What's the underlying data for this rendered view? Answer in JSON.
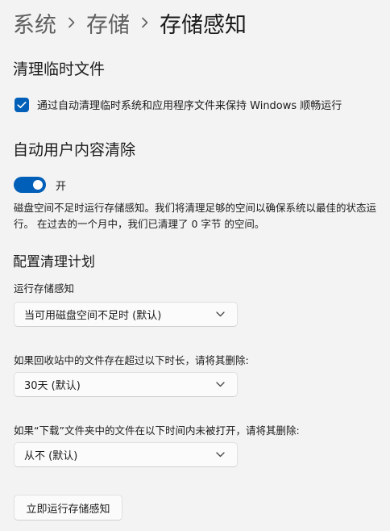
{
  "breadcrumb": {
    "items": [
      "系统",
      "存储"
    ],
    "current": "存储感知"
  },
  "temp_files": {
    "title": "清理临时文件",
    "checkbox_label": "通过自动清理临时系统和应用程序文件来保持 Windows 顺畅运行",
    "checked": true
  },
  "auto_cleanup": {
    "title": "自动用户内容清除",
    "toggle_state": "开",
    "toggle_on": true,
    "description": "磁盘空间不足时运行存储感知。我们将清理足够的空间以确保系统以最佳的状态运行。 在过去的一个月中，我们已清理了 0 字节 的空间。"
  },
  "schedule": {
    "title": "配置清理计划",
    "run_label": "运行存储感知",
    "run_value": "当可用磁盘空间不足时 (默认)",
    "recycle_label": "如果回收站中的文件存在超过以下时长，请将其删除:",
    "recycle_value": "30天 (默认)",
    "downloads_label": "如果“下载”文件夹中的文件在以下时间内未被打开，请将其删除:",
    "downloads_value": "从不 (默认)"
  },
  "run_now_button": "立即运行存储感知",
  "colors": {
    "accent": "#005fb8",
    "background": "#f3f3f3"
  },
  "icons": {
    "breadcrumb_separator": "chevron-right-icon",
    "dropdown": "chevron-down-icon",
    "checkbox": "checkmark-icon"
  }
}
